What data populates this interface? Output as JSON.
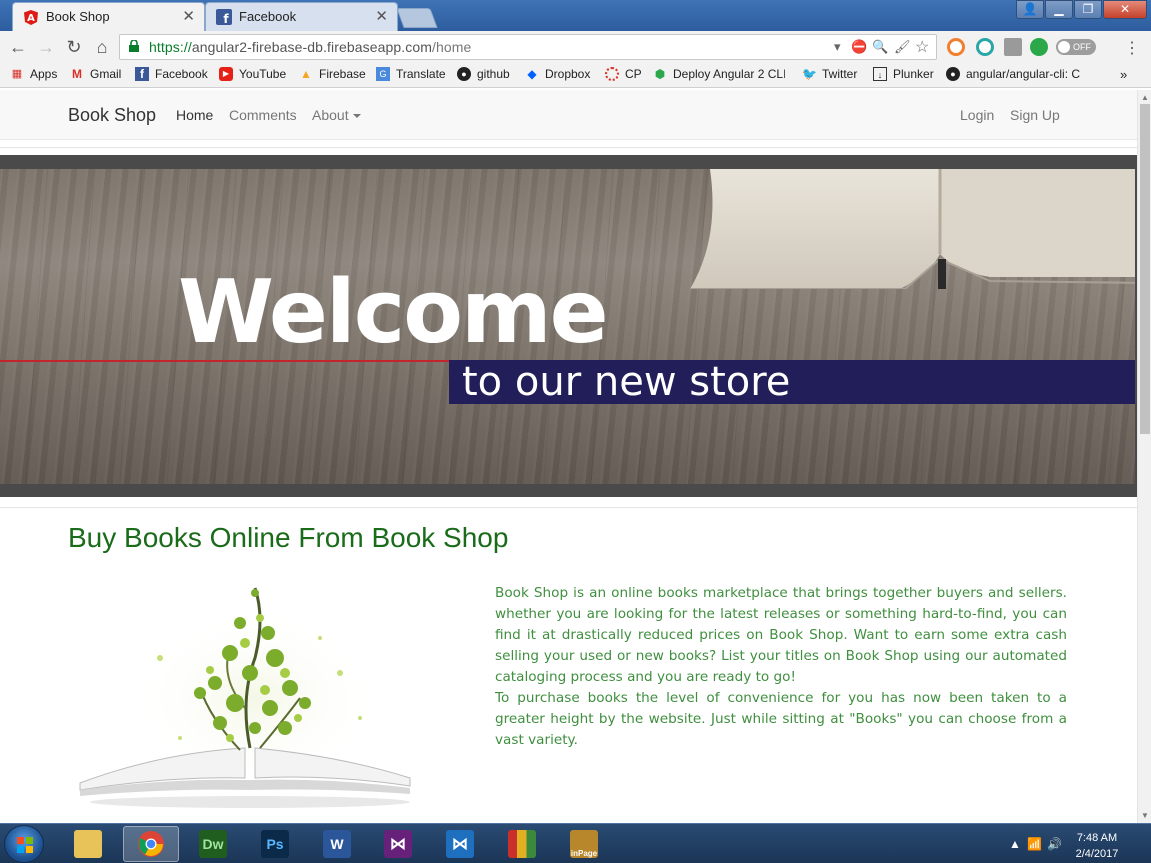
{
  "browser": {
    "tabs": [
      {
        "title": "Book Shop",
        "active": true
      },
      {
        "title": "Facebook",
        "active": false
      }
    ],
    "url": {
      "scheme": "https://",
      "host": "angular2-firebase-db.firebaseapp.com",
      "path": "/home"
    },
    "extension_toggle": "OFF",
    "bookmarks": [
      "Apps",
      "Gmail",
      "Facebook",
      "YouTube",
      "Firebase",
      "Translate",
      "github",
      "Dropbox",
      "CP",
      "Deploy Angular 2 CLI",
      "Twitter",
      "Plunker",
      "angular/angular-cli: C"
    ],
    "bookmarks_overflow": "»"
  },
  "site": {
    "brand": "Book Shop",
    "nav": {
      "home": "Home",
      "comments": "Comments",
      "about": "About"
    },
    "auth": {
      "login": "Login",
      "signup": "Sign Up"
    },
    "hero": {
      "welcome": "Welcome",
      "tagline": "to our new store"
    },
    "heading": "Buy Books Online From Book Shop",
    "paragraphs": [
      "Book Shop is an online books marketplace that brings together buyers and sellers. whether you are looking for the latest releases or something hard-to-find, you can find it at drastically reduced prices on Book Shop. Want to earn some extra cash selling your used or new books? List your titles on Book Shop using our automated cataloging process and you are ready to go!",
      "To purchase books the level of convenience for you has now been taken to a greater height by the website. Just while sitting at \"Books\" you can choose from a vast variety."
    ]
  },
  "taskbar": {
    "apps": [
      {
        "label": "Dw",
        "color": "#1f5e1f",
        "fg": "#9fe39f"
      },
      {
        "label": "Ps",
        "color": "#0b2a4a",
        "fg": "#58b7ff"
      },
      {
        "label": "W",
        "color": "#2b579a",
        "fg": "#ffffff"
      },
      {
        "label": "VS",
        "color": "#68217a",
        "fg": "#ffffff"
      },
      {
        "label": "VC",
        "color": "#1e6fbe",
        "fg": "#ffffff"
      },
      {
        "label": "",
        "color": "#e0b020",
        "fg": "#ffffff"
      },
      {
        "label": "inPage",
        "color": "#b8862b",
        "fg": "#ffffff"
      }
    ],
    "time": "7:48 AM",
    "date": "2/4/2017"
  }
}
